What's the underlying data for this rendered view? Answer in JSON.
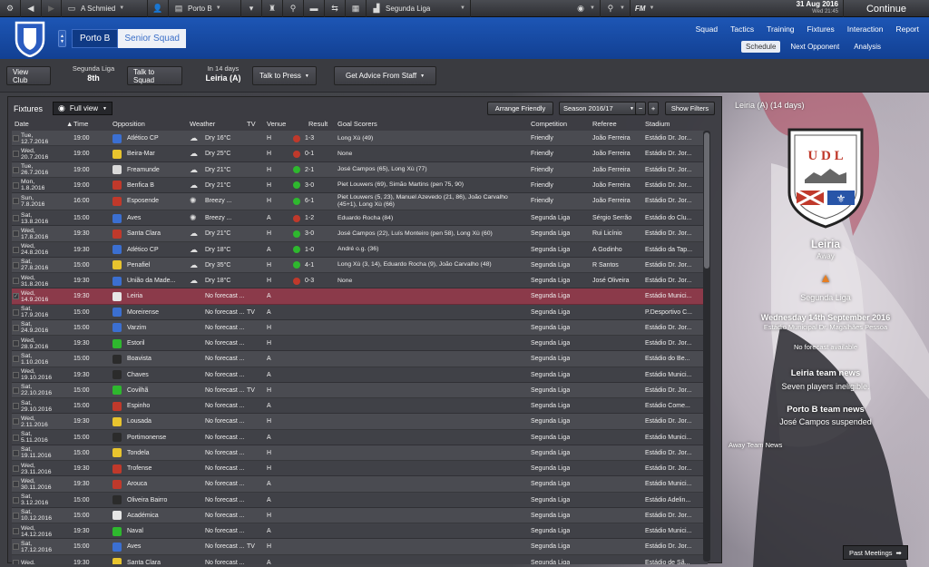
{
  "topbar": {
    "manager": "A Schmied",
    "club": "Porto B",
    "league": "Segunda Liga",
    "fm_label": "FM",
    "date": "31 Aug 2016",
    "weekday_time": "Wed 21:45",
    "continue": "Continue"
  },
  "header": {
    "club_tab": "Porto B",
    "squad_tab": "Senior Squad",
    "nav": [
      "Squad",
      "Tactics",
      "Training",
      "Fixtures",
      "Interaction",
      "Report"
    ],
    "subnav": [
      "Schedule",
      "Next Opponent",
      "Analysis"
    ]
  },
  "actions": {
    "view_club": "View Club",
    "league_name": "Segunda Liga",
    "league_pos": "8th",
    "talk_squad": "Talk to Squad",
    "in_days": "In 14 days",
    "next_opp": "Leiria (A)",
    "talk_press": "Talk to Press",
    "advice": "Get Advice From Staff"
  },
  "fixtures": {
    "title": "Fixtures",
    "view": "Full view",
    "arrange": "Arrange Friendly",
    "season": "Season 2016/17",
    "show_filters": "Show Filters",
    "columns": [
      "Date",
      "Time",
      "Opposition",
      "Weather",
      "TV",
      "Venue",
      "Result",
      "Goal Scorers",
      "Competition",
      "Referee",
      "Stadium"
    ],
    "rows": [
      {
        "d1": "Tue,",
        "d2": "12.7.2016",
        "time": "19:00",
        "opp": "Atlético CP",
        "weather": "Dry 16°C",
        "tv": "",
        "venue": "H",
        "result": "1-3",
        "res": "L",
        "scorers": "Long Xù (49)",
        "comp": "Friendly",
        "ref": "João Ferreira",
        "stadium": "Estádio Dr. Jor..."
      },
      {
        "d1": "Wed,",
        "d2": "20.7.2016",
        "time": "19:00",
        "opp": "Beira-Mar",
        "weather": "Dry 25°C",
        "tv": "",
        "venue": "H",
        "result": "0-1",
        "res": "L",
        "scorers": "None",
        "comp": "Friendly",
        "ref": "João Ferreira",
        "stadium": "Estádio Dr. Jor..."
      },
      {
        "d1": "Tue,",
        "d2": "26.7.2016",
        "time": "19:00",
        "opp": "Freamunde",
        "weather": "Dry 21°C",
        "tv": "",
        "venue": "H",
        "result": "2-1",
        "res": "W",
        "scorers": "José Campos (65), Long Xù (77)",
        "comp": "Friendly",
        "ref": "João Ferreira",
        "stadium": "Estádio Dr. Jor..."
      },
      {
        "d1": "Mon,",
        "d2": "1.8.2016",
        "time": "19:00",
        "opp": "Benfica B",
        "weather": "Dry 21°C",
        "tv": "",
        "venue": "H",
        "result": "3-0",
        "res": "W",
        "scorers": "Piet Louwers (69), Simão Martins (pen 75, 90)",
        "comp": "Friendly",
        "ref": "João Ferreira",
        "stadium": "Estádio Dr. Jor..."
      },
      {
        "d1": "Sun,",
        "d2": "7.8.2016",
        "time": "16:00",
        "opp": "Esposende",
        "weather": "Breezy ...",
        "tv": "",
        "venue": "H",
        "result": "6-1",
        "res": "W",
        "scorers": "Piet Louwers (5, 23), Manuel Azevedo (21, 86), João Carvalho (45+1), Long Xù (66)",
        "comp": "Friendly",
        "ref": "João Ferreira",
        "stadium": "Estádio Dr. Jor...",
        "tall": true
      },
      {
        "d1": "Sat,",
        "d2": "13.8.2016",
        "time": "15:00",
        "opp": "Aves",
        "weather": "Breezy ...",
        "tv": "",
        "venue": "A",
        "result": "1-2",
        "res": "L",
        "scorers": "Eduardo Rocha (84)",
        "comp": "Segunda Liga",
        "ref": "Sérgio Serrão",
        "stadium": "Estádio do Clu..."
      },
      {
        "d1": "Wed,",
        "d2": "17.8.2016",
        "time": "19:30",
        "opp": "Santa Clara",
        "weather": "Dry 21°C",
        "tv": "",
        "venue": "H",
        "result": "3-0",
        "res": "W",
        "scorers": "José Campos (22), Luís Monteiro (pen 58), Long Xù (60)",
        "comp": "Segunda Liga",
        "ref": "Rui Licínio",
        "stadium": "Estádio Dr. Jor..."
      },
      {
        "d1": "Wed,",
        "d2": "24.8.2016",
        "time": "19:30",
        "opp": "Atlético CP",
        "weather": "Dry 18°C",
        "tv": "",
        "venue": "A",
        "result": "1-0",
        "res": "W",
        "scorers": "André o.g. (36)",
        "comp": "Segunda Liga",
        "ref": "A Godinho",
        "stadium": "Estádio da Tap..."
      },
      {
        "d1": "Sat,",
        "d2": "27.8.2016",
        "time": "15:00",
        "opp": "Penafiel",
        "weather": "Dry 35°C",
        "tv": "",
        "venue": "H",
        "result": "4-1",
        "res": "W",
        "scorers": "Long Xù (3, 14), Eduardo Rocha (9), João Carvalho (48)",
        "comp": "Segunda Liga",
        "ref": "R Santos",
        "stadium": "Estádio Dr. Jor..."
      },
      {
        "d1": "Wed,",
        "d2": "31.8.2016",
        "time": "19:30",
        "opp": "União da Made...",
        "weather": "Dry 18°C",
        "tv": "",
        "venue": "H",
        "result": "0-3",
        "res": "L",
        "scorers": "None",
        "comp": "Segunda Liga",
        "ref": "José Oliveira",
        "stadium": "Estádio Dr. Jor..."
      },
      {
        "d1": "Wed,",
        "d2": "14.9.2016",
        "time": "19:30",
        "opp": "Leiria",
        "weather": "No forecast ...",
        "tv": "",
        "venue": "A",
        "result": "",
        "res": "",
        "scorers": "",
        "comp": "Segunda Liga",
        "ref": "",
        "stadium": "Estádio Munici...",
        "sel": true
      },
      {
        "d1": "Sat,",
        "d2": "17.9.2016",
        "time": "15:00",
        "opp": "Moreirense",
        "weather": "No forecast ...",
        "tv": "TV",
        "venue": "A",
        "result": "",
        "res": "",
        "scorers": "",
        "comp": "Segunda Liga",
        "ref": "",
        "stadium": "P.Desportivo C..."
      },
      {
        "d1": "Sat,",
        "d2": "24.9.2016",
        "time": "15:00",
        "opp": "Varzim",
        "weather": "No forecast ...",
        "tv": "",
        "venue": "H",
        "result": "",
        "res": "",
        "scorers": "",
        "comp": "Segunda Liga",
        "ref": "",
        "stadium": "Estádio Dr. Jor..."
      },
      {
        "d1": "Wed,",
        "d2": "28.9.2016",
        "time": "19:30",
        "opp": "Estoril",
        "weather": "No forecast ...",
        "tv": "",
        "venue": "H",
        "result": "",
        "res": "",
        "scorers": "",
        "comp": "Segunda Liga",
        "ref": "",
        "stadium": "Estádio Dr. Jor..."
      },
      {
        "d1": "Sat,",
        "d2": "1.10.2016",
        "time": "15:00",
        "opp": "Boavista",
        "weather": "No forecast ...",
        "tv": "",
        "venue": "A",
        "result": "",
        "res": "",
        "scorers": "",
        "comp": "Segunda Liga",
        "ref": "",
        "stadium": "Estádio do Be..."
      },
      {
        "d1": "Wed,",
        "d2": "19.10.2016",
        "time": "19:30",
        "opp": "Chaves",
        "weather": "No forecast ...",
        "tv": "",
        "venue": "A",
        "result": "",
        "res": "",
        "scorers": "",
        "comp": "Segunda Liga",
        "ref": "",
        "stadium": "Estádio Munici..."
      },
      {
        "d1": "Sat,",
        "d2": "22.10.2016",
        "time": "15:00",
        "opp": "Covilhã",
        "weather": "No forecast ...",
        "tv": "TV",
        "venue": "H",
        "result": "",
        "res": "",
        "scorers": "",
        "comp": "Segunda Liga",
        "ref": "",
        "stadium": "Estádio Dr. Jor..."
      },
      {
        "d1": "Sat,",
        "d2": "29.10.2016",
        "time": "15:00",
        "opp": "Espinho",
        "weather": "No forecast ...",
        "tv": "",
        "venue": "A",
        "result": "",
        "res": "",
        "scorers": "",
        "comp": "Segunda Liga",
        "ref": "",
        "stadium": "Estádio Come..."
      },
      {
        "d1": "Wed,",
        "d2": "2.11.2016",
        "time": "19:30",
        "opp": "Lousada",
        "weather": "No forecast ...",
        "tv": "",
        "venue": "H",
        "result": "",
        "res": "",
        "scorers": "",
        "comp": "Segunda Liga",
        "ref": "",
        "stadium": "Estádio Dr. Jor..."
      },
      {
        "d1": "Sat,",
        "d2": "5.11.2016",
        "time": "15:00",
        "opp": "Portimonense",
        "weather": "No forecast ...",
        "tv": "",
        "venue": "A",
        "result": "",
        "res": "",
        "scorers": "",
        "comp": "Segunda Liga",
        "ref": "",
        "stadium": "Estádio Munici..."
      },
      {
        "d1": "Sat,",
        "d2": "19.11.2016",
        "time": "15:00",
        "opp": "Tondela",
        "weather": "No forecast ...",
        "tv": "",
        "venue": "H",
        "result": "",
        "res": "",
        "scorers": "",
        "comp": "Segunda Liga",
        "ref": "",
        "stadium": "Estádio Dr. Jor..."
      },
      {
        "d1": "Wed,",
        "d2": "23.11.2016",
        "time": "19:30",
        "opp": "Trofense",
        "weather": "No forecast ...",
        "tv": "",
        "venue": "H",
        "result": "",
        "res": "",
        "scorers": "",
        "comp": "Segunda Liga",
        "ref": "",
        "stadium": "Estádio Dr. Jor..."
      },
      {
        "d1": "Wed,",
        "d2": "30.11.2016",
        "time": "19:30",
        "opp": "Arouca",
        "weather": "No forecast ...",
        "tv": "",
        "venue": "A",
        "result": "",
        "res": "",
        "scorers": "",
        "comp": "Segunda Liga",
        "ref": "",
        "stadium": "Estádio Munici..."
      },
      {
        "d1": "Sat,",
        "d2": "3.12.2016",
        "time": "15:00",
        "opp": "Oliveira Bairro",
        "weather": "No forecast ...",
        "tv": "",
        "venue": "A",
        "result": "",
        "res": "",
        "scorers": "",
        "comp": "Segunda Liga",
        "ref": "",
        "stadium": "Estádio Adelin..."
      },
      {
        "d1": "Sat,",
        "d2": "10.12.2016",
        "time": "15:00",
        "opp": "Académica",
        "weather": "No forecast ...",
        "tv": "",
        "venue": "H",
        "result": "",
        "res": "",
        "scorers": "",
        "comp": "Segunda Liga",
        "ref": "",
        "stadium": "Estádio Dr. Jor..."
      },
      {
        "d1": "Wed,",
        "d2": "14.12.2016",
        "time": "19:30",
        "opp": "Naval",
        "weather": "No forecast ...",
        "tv": "",
        "venue": "A",
        "result": "",
        "res": "",
        "scorers": "",
        "comp": "Segunda Liga",
        "ref": "",
        "stadium": "Estádio Munici..."
      },
      {
        "d1": "Sat,",
        "d2": "17.12.2016",
        "time": "15:00",
        "opp": "Aves",
        "weather": "No forecast ...",
        "tv": "TV",
        "venue": "H",
        "result": "",
        "res": "",
        "scorers": "",
        "comp": "Segunda Liga",
        "ref": "",
        "stadium": "Estádio Dr. Jor..."
      },
      {
        "d1": "Wed,",
        "d2": "",
        "time": "19:30",
        "opp": "Santa Clara",
        "weather": "No forecast ...",
        "tv": "",
        "venue": "A",
        "result": "",
        "res": "",
        "scorers": "",
        "comp": "Segunda Liga",
        "ref": "",
        "stadium": "Estádio de Sã..."
      }
    ]
  },
  "side": {
    "title": "Leiria (A) (14 days)",
    "crest_text": "U D L",
    "team": "Leiria",
    "venue": "Away",
    "competition": "Segunda Liga",
    "date": "Wednesday 14th September 2016",
    "stadium": "Estádio Municipal Dr. Magalhães Pessoa",
    "forecast": "No forecast available",
    "opp_news_title": "Leiria team news",
    "opp_news": "Seven players ineligible.",
    "own_news_title": "Porto B team news",
    "own_news": "José Campos suspended",
    "away_news": "Away Team News",
    "past_meetings": "Past Meetings"
  },
  "colors": {
    "win": "#2eb82e",
    "loss": "#c0392b",
    "header": "#1a4fa8",
    "selected": "#8b3a4a"
  }
}
